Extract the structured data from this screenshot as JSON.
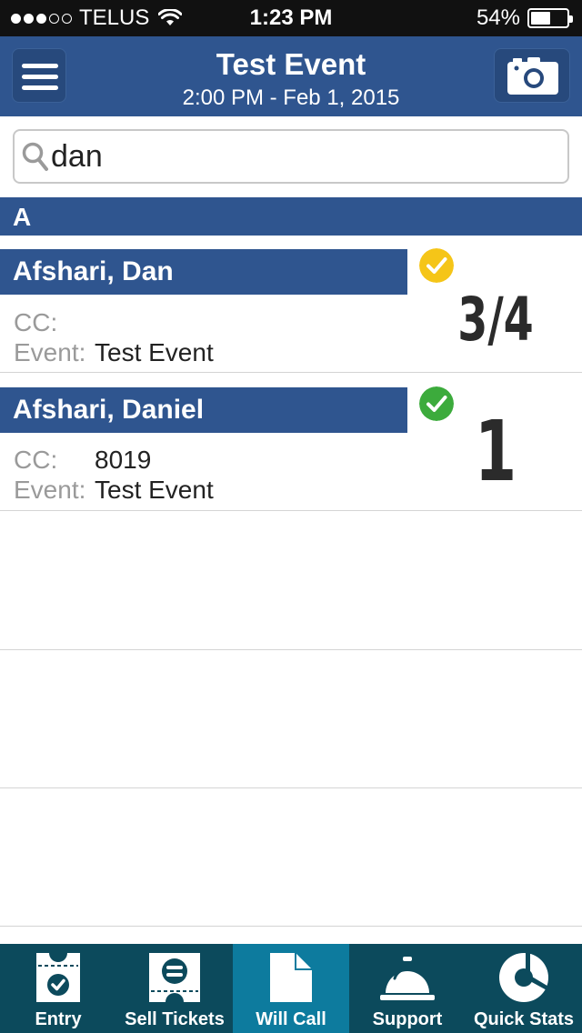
{
  "status_bar": {
    "carrier": "TELUS",
    "time": "1:23 PM",
    "battery": "54%",
    "battery_level": 0.54,
    "signal_bars": 3,
    "signal_total": 5
  },
  "header": {
    "title": "Test Event",
    "subtitle": "2:00 PM - Feb 1, 2015",
    "menu_icon": "hamburger-menu-icon",
    "camera_icon": "camera-icon"
  },
  "search": {
    "value": "dan",
    "icon": "search-icon"
  },
  "section": {
    "letter": "A"
  },
  "rows": [
    {
      "name": "Afshari, Dan",
      "cc_label": "CC:",
      "cc_value": "",
      "event_label": "Event:",
      "event_value": "Test Event",
      "count": "3/4",
      "status": "partial",
      "status_color": "#f5c518"
    },
    {
      "name": "Afshari, Daniel",
      "cc_label": "CC:",
      "cc_value": "8019",
      "event_label": "Event:",
      "event_value": "Test Event",
      "count": "1",
      "status": "complete",
      "status_color": "#3cab3c"
    }
  ],
  "tabs": [
    {
      "label": "Entry",
      "icon": "ticket-check-icon"
    },
    {
      "label": "Sell Tickets",
      "icon": "ticket-icon"
    },
    {
      "label": "Will Call",
      "icon": "document-icon",
      "active": true
    },
    {
      "label": "Support",
      "icon": "service-bell-icon"
    },
    {
      "label": "Quick Stats",
      "icon": "pie-chart-icon"
    }
  ],
  "colors": {
    "brand_blue": "#2f558f",
    "tabbar": "#0c4a5c",
    "tab_active": "#0d7b9e"
  }
}
